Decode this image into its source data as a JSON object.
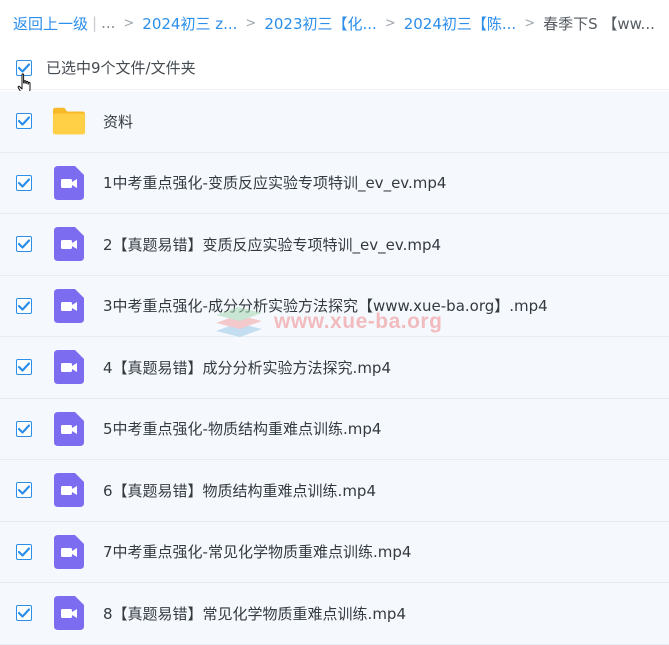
{
  "breadcrumb": {
    "back_label": "返回上一级",
    "ellipsis": "...",
    "crumbs": [
      "2024初三 z...",
      "2023初三【化...",
      "2024初三【陈..."
    ],
    "current": "春季下S 【ww..."
  },
  "selection": {
    "text": "已选中9个文件/文件夹"
  },
  "files": [
    {
      "name": "资料",
      "type": "folder"
    },
    {
      "name": "1中考重点强化-变质反应实验专项特训_ev_ev.mp4",
      "type": "video"
    },
    {
      "name": "2【真题易错】变质反应实验专项特训_ev_ev.mp4",
      "type": "video"
    },
    {
      "name": "3中考重点强化-成分分析实验方法探究【www.xue-ba.org】.mp4",
      "type": "video"
    },
    {
      "name": "4【真题易错】成分分析实验方法探究.mp4",
      "type": "video"
    },
    {
      "name": "5中考重点强化-物质结构重难点训练.mp4",
      "type": "video"
    },
    {
      "name": "6【真题易错】物质结构重难点训练.mp4",
      "type": "video"
    },
    {
      "name": "7中考重点强化-常见化学物质重难点训练.mp4",
      "type": "video"
    },
    {
      "name": "8【真题易错】常见化学物质重难点训练.mp4",
      "type": "video"
    }
  ],
  "watermark": {
    "text": "www.xue-ba.org"
  },
  "colors": {
    "accent": "#2b8eea",
    "folder": "#ffc93c",
    "video": "#7b6cf0",
    "row_bg": "#f5f9fe"
  },
  "icons": {
    "folder": "folder-icon",
    "video": "video-file-icon",
    "check": "check-icon",
    "cursor": "hand-cursor-icon"
  }
}
